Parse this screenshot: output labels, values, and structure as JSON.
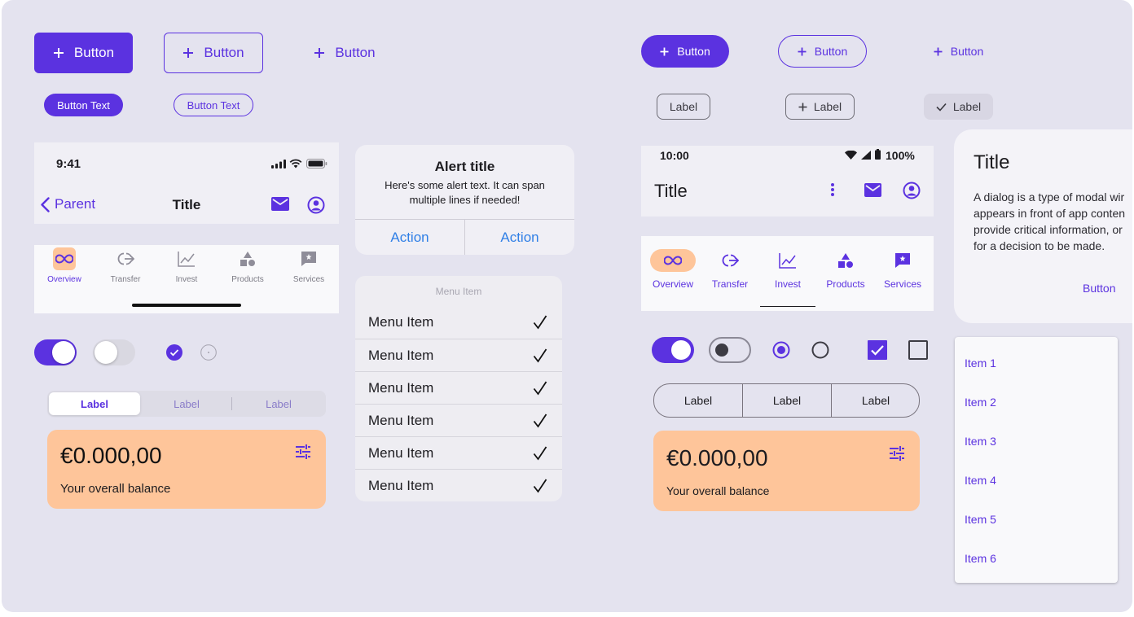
{
  "ios_buttons": {
    "filled": "Button",
    "outlined": "Button",
    "text": "Button",
    "small_filled": "Button Text",
    "small_outlined": "Button Text"
  },
  "material_buttons": {
    "filled": "Button",
    "outlined": "Button",
    "text": "Button"
  },
  "chips": [
    "Label",
    "Label",
    "Label"
  ],
  "ios_nav": {
    "time": "9:41",
    "back_label": "Parent",
    "title": "Title"
  },
  "ios_tabs": [
    "Overview",
    "Transfer",
    "Invest",
    "Products",
    "Services"
  ],
  "alert": {
    "title": "Alert title",
    "body_line1": "Here's some alert text. It can span",
    "body_line2": "multiple lines if needed!",
    "action1": "Action",
    "action2": "Action"
  },
  "menu": {
    "header": "Menu Item",
    "items": [
      "Menu Item",
      "Menu Item",
      "Menu Item",
      "Menu Item",
      "Menu Item",
      "Menu Item"
    ]
  },
  "ios_segmented": [
    "Label",
    "Label",
    "Label"
  ],
  "ios_balance": {
    "amount": "€0.000,00",
    "caption": "Your overall balance"
  },
  "android_status": {
    "time": "10:00",
    "battery": "100%"
  },
  "android_appbar": {
    "title": "Title"
  },
  "android_tabs": [
    "Overview",
    "Transfer",
    "Invest",
    "Products",
    "Services"
  ],
  "material_segmented": [
    "Label",
    "Label",
    "Label"
  ],
  "material_balance": {
    "amount": "€0.000,00",
    "caption": "Your overall balance"
  },
  "dialog": {
    "title": "Title",
    "line1": "A dialog is a type of modal wir",
    "line2": "appears in front of app conten",
    "line3": "provide critical information, or",
    "line4": "for a decision to be made.",
    "button": "Button"
  },
  "list": [
    "Item 1",
    "Item 2",
    "Item 3",
    "Item 4",
    "Item 5",
    "Item 6"
  ],
  "colors": {
    "primary": "#5b32e0",
    "background": "#e4e3ef",
    "balance_card": "#fec59a"
  }
}
